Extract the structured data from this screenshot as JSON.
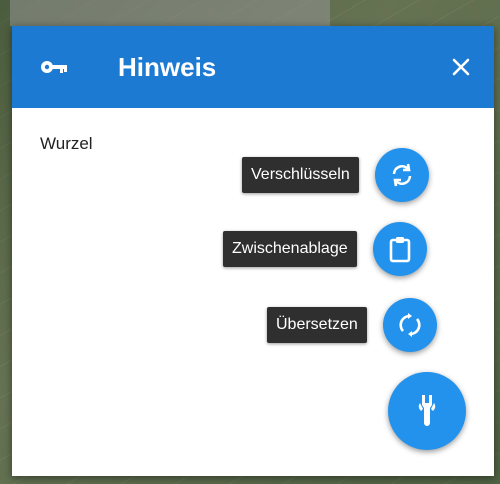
{
  "dialog": {
    "title": "Hinweis",
    "header_icon": "key-icon",
    "close_icon": "close-icon",
    "content_text": "Wurzel"
  },
  "actions": [
    {
      "label": "Verschlüsseln",
      "icon": "sync-arrows-icon"
    },
    {
      "label": "Zwischenablage",
      "icon": "clipboard-icon"
    },
    {
      "label": "Übersetzen",
      "icon": "rotate-icon"
    }
  ],
  "main_fab": {
    "icon": "tools-icon"
  },
  "colors": {
    "header": "#1d7ad3",
    "fab": "#2392ec",
    "chip": "#2f2f2f"
  }
}
